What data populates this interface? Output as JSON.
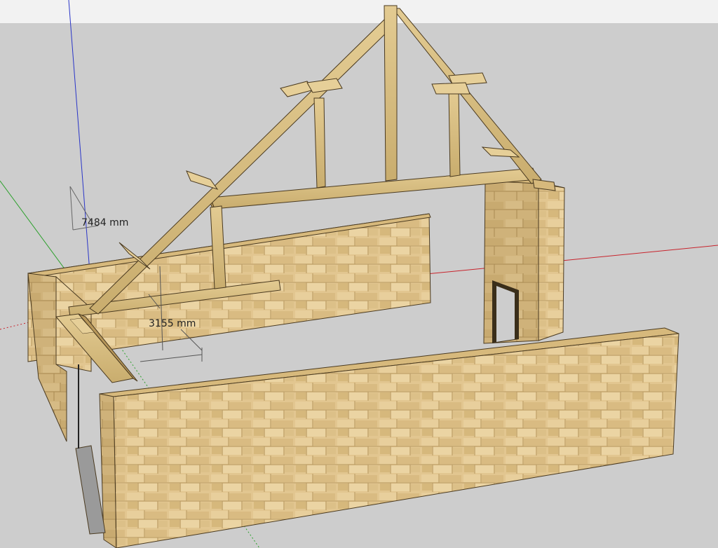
{
  "dimensions": {
    "ridge_height": "7484 mm",
    "wall_height": "3155 mm"
  },
  "colors": {
    "sky": "#cdcdcd",
    "toolbar": "#f2f2f2",
    "timber": "#dcc48a",
    "timber_dark": "#a88a4e",
    "stone": "#e2c690",
    "stone_mortar": "#b89a62",
    "axis_red": "#c8232c",
    "axis_green": "#2ca02c",
    "axis_blue": "#2a35c8"
  }
}
